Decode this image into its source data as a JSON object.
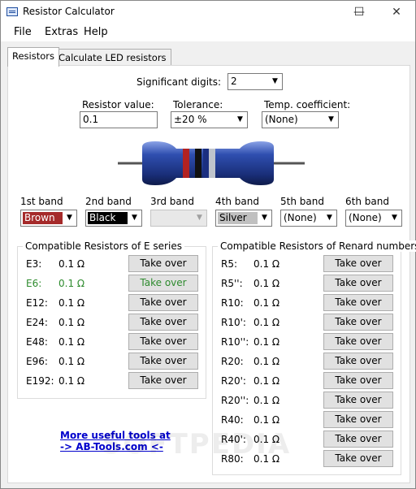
{
  "window": {
    "title": "Resistor Calculator",
    "controls": {
      "minimize": "—",
      "maximize": "☐",
      "close": "✕"
    }
  },
  "menu": [
    "File",
    "Extras",
    "Help"
  ],
  "tabs": [
    "Resistors",
    "Calculate LED resistors"
  ],
  "significant_digits": {
    "label": "Significant digits:",
    "value": "2"
  },
  "resistor_value": {
    "label": "Resistor value:",
    "value": "0.1"
  },
  "tolerance": {
    "label": "Tolerance:",
    "value": "±20 %"
  },
  "temp_coefficient": {
    "label": "Temp. coefficient:",
    "value": "(None)"
  },
  "bands": [
    {
      "label": "1st band",
      "value": "Brown",
      "color": "#a52a2a",
      "text_color": "#ffffff"
    },
    {
      "label": "2nd band",
      "value": "Black",
      "color": "#000000",
      "text_color": "#ffffff"
    },
    {
      "label": "3rd band",
      "value": "",
      "color": "",
      "text_color": ""
    },
    {
      "label": "4th band",
      "value": "Silver",
      "color": "#c0c0c0",
      "text_color": "#000000"
    },
    {
      "label": "5th band",
      "value": "(None)",
      "color": "",
      "text_color": ""
    },
    {
      "label": "6th band",
      "value": "(None)",
      "color": "",
      "text_color": ""
    }
  ],
  "resistor_image": {
    "body_color": "#2a4aa8",
    "band_colors": [
      "#b22222",
      "#111111",
      "#1b2f80",
      "#bfc4cc"
    ]
  },
  "e_series": {
    "title": "Compatible Resistors of E series",
    "button_label": "Take over",
    "rows": [
      {
        "name": "E3:",
        "value": "0.1 Ω",
        "highlight": false
      },
      {
        "name": "E6:",
        "value": "0.1 Ω",
        "highlight": true
      },
      {
        "name": "E12:",
        "value": "0.1 Ω",
        "highlight": false
      },
      {
        "name": "E24:",
        "value": "0.1 Ω",
        "highlight": false
      },
      {
        "name": "E48:",
        "value": "0.1 Ω",
        "highlight": false
      },
      {
        "name": "E96:",
        "value": "0.1 Ω",
        "highlight": false
      },
      {
        "name": "E192:",
        "value": "0.1 Ω",
        "highlight": false
      }
    ]
  },
  "renard": {
    "title": "Compatible Resistors of Renard numbers",
    "button_label": "Take over",
    "rows": [
      {
        "name": "R5:",
        "value": "0.1 Ω"
      },
      {
        "name": "R5'':",
        "value": "0.1 Ω"
      },
      {
        "name": "R10:",
        "value": "0.1 Ω"
      },
      {
        "name": "R10':",
        "value": "0.1 Ω"
      },
      {
        "name": "R10'':",
        "value": "0.1 Ω"
      },
      {
        "name": "R20:",
        "value": "0.1 Ω"
      },
      {
        "name": "R20':",
        "value": "0.1 Ω"
      },
      {
        "name": "R20'':",
        "value": "0.1 Ω"
      },
      {
        "name": "R40:",
        "value": "0.1 Ω"
      },
      {
        "name": "R40':",
        "value": "0.1 Ω"
      },
      {
        "name": "R80:",
        "value": "0.1 Ω"
      }
    ]
  },
  "link": {
    "line1": "More useful tools at",
    "line2": "-> AB-Tools.com <-"
  },
  "watermark": "SOFTPEDIA",
  "colors": {
    "highlight_text": "#2e8b2e",
    "link": "#0000cc"
  }
}
